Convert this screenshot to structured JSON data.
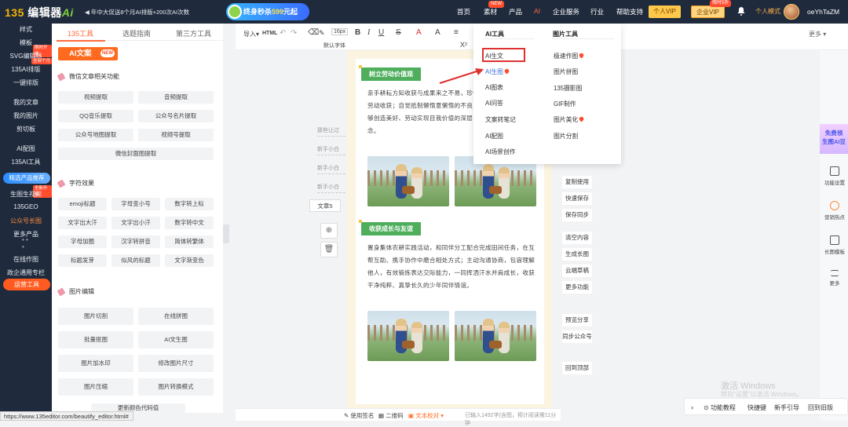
{
  "topbar": {
    "logo_prefix": "135",
    "logo_name": "编辑器",
    "logo_suffix": "Ai",
    "promo": "◀ 年中大促送8个月AI排版+200次AI次数",
    "banner_main": "终身秒杀",
    "banner_price": "599",
    "banner_unit": "元起",
    "nav": [
      "首页",
      "素材",
      "产品",
      "AI",
      "企业服务",
      "行业",
      "帮助支持"
    ],
    "nav_new_badge": "NEW",
    "personal_vip": "个人VIP",
    "enterprise_vip": "企业VIP",
    "enterprise_badge": "限时5折",
    "mode": "个人模式",
    "username": "oeYhTaZM"
  },
  "sidebar": {
    "items": [
      "样式",
      "模板",
      "SVG编辑器",
      "135AI排版",
      "一键排版",
      "我的文章",
      "我的图片",
      "剪切板",
      "AI配图",
      "135AI工具",
      "精选产品推荐",
      "生图生视频",
      "135GEO",
      "公众号长图",
      "更多产品",
      "在线作图",
      "政企通用专栏",
      "运营工具"
    ],
    "svg_badge": "限时开放",
    "ai_badge": "全部个月",
    "video_badge": "全新升级"
  },
  "tools": {
    "tabs": [
      "135工具",
      "选题指南",
      "第三方工具"
    ],
    "ai_label": "AI文案",
    "ai_new": "NEW",
    "section1": "微信文章相关功能",
    "section1_buttons": [
      "视频提取",
      "音频提取",
      "QQ音乐提取",
      "公众号名片提取",
      "公众号地图提取",
      "视频号提取",
      "微信封面图提取"
    ],
    "section2": "字符效果",
    "section2_buttons": [
      "emoji标题",
      "字母变小号",
      "数字转上标",
      "文字出大汗",
      "文字出小汗",
      "数字转中文",
      "字母加圈",
      "汉字转拼音",
      "简体转繁体",
      "标题发芽",
      "似风的标题",
      "文字渐变色"
    ],
    "section3": "图片编辑",
    "section3_buttons": [
      "图片切割",
      "在线拼图",
      "批量抠图",
      "AI文生图",
      "图片加水印",
      "修改图片尺寸",
      "图片压缩",
      "图片转换模式",
      "更新颜色代码值"
    ]
  },
  "toolbar": {
    "import": "导入▾",
    "html": "HTML",
    "font_size": "16px",
    "default_font": "默认字体",
    "more": "更多 ▾"
  },
  "history": {
    "rows": [
      "那些让过",
      "新手小白",
      "新手小白",
      "新手小白"
    ],
    "article": "文章5"
  },
  "menu": {
    "ai_tools_title": "AI工具",
    "image_tools_title": "图片工具",
    "ai_tools": [
      "AI生文",
      "AI生图",
      "AI图表",
      "AI问答",
      "文案转笔记",
      "AI配图",
      "AI场景创作"
    ],
    "image_tools": [
      "极速作图",
      "图片拼图",
      "135摄影图",
      "GIF制作",
      "图片美化",
      "图片分割"
    ]
  },
  "article": {
    "heading1": "树立劳动价值观",
    "para1": "亲手耕耘方知收获与成果来之不易，珍惜所有劳动者与每一份劳动收获；自觉抵制懒惰意懒惰的不良习惯，真切领悟劳动能够创造美好、劳动实现目我价值的深层内涵，树立正的劳动观念。",
    "heading2": "收获成长与友谊",
    "para2": "置身集体农耕实践活动，和同伴分工配合完成田间任务，在互帮互助、携手协作中磨合相处方式；主动沟通协商，包容理解他人，有效锻炼表达交际能力，一同挥洒汗水并肩成长，收获干净纯粹、真挚长久的少年同伴情谊。"
  },
  "right_tools": [
    "复制使用",
    "快速保存",
    "保存同步",
    "清空内容",
    "生成长图",
    "云端草稿",
    "更多功能",
    "预览分享",
    "同步公众号",
    "回到顶部"
  ],
  "right_panel": {
    "free_line1": "免费领",
    "free_line2": "生图AI豆",
    "items": [
      "功能设置",
      "营销热点",
      "长图模板",
      "更多"
    ]
  },
  "statusbar": {
    "signature": "使用签名",
    "qrcode": "二维码",
    "proofread": "文本校对 ▾",
    "count": "已输入1492字(含图，预计阅读需11分钟"
  },
  "bottomnav": [
    "功能教程",
    "快捷键",
    "新手引导",
    "回到旧版"
  ],
  "watermark": {
    "line1": "激活 Windows",
    "line2": "转到\"设置\"以激活 Windows。"
  },
  "url": "https://www.135editor.com/beautify_editor.html#",
  "colors": {
    "accent": "#ff6a3d",
    "dark": "#1f2b3d",
    "green": "#4eae5c",
    "link": "#3a6edc"
  }
}
